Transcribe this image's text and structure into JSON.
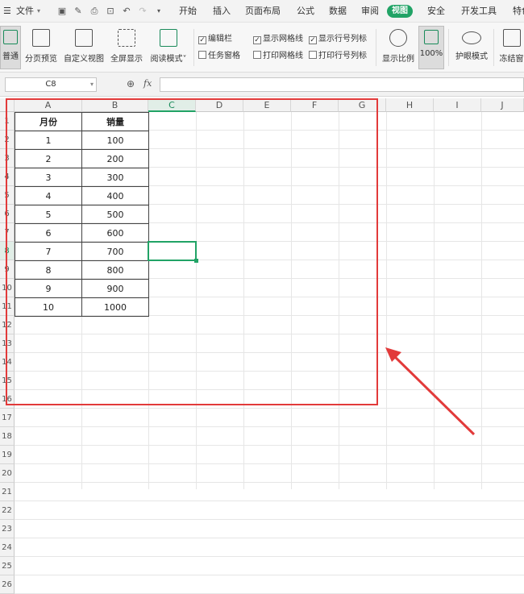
{
  "menubar": {
    "file_label": "文件",
    "tabs": [
      "开始",
      "插入",
      "页面布局",
      "公式",
      "数据",
      "审阅",
      "视图",
      "安全",
      "开发工具",
      "特色"
    ],
    "active_tab": "视图",
    "quick_icons": [
      "save-icon",
      "format-painter-icon",
      "print-icon",
      "print-preview-icon",
      "undo-icon",
      "redo-icon",
      "more-icon"
    ]
  },
  "ribbon": {
    "buttons": [
      {
        "label": "普通",
        "selected": true
      },
      {
        "label": "分页预览",
        "selected": false
      },
      {
        "label": "自定义视图",
        "selected": false
      },
      {
        "label": "全屏显示",
        "selected": false
      },
      {
        "label": "阅读模式",
        "selected": false
      }
    ],
    "checks": [
      {
        "label": "编辑栏",
        "checked": true
      },
      {
        "label": "任务窗格",
        "checked": false
      },
      {
        "label": "显示网格线",
        "checked": true
      },
      {
        "label": "打印网格线",
        "checked": false
      },
      {
        "label": "显示行号列标",
        "checked": true
      },
      {
        "label": "打印行号列标",
        "checked": false
      }
    ],
    "zoom_label": "显示比例",
    "zoom_100_label": "100%",
    "eye_label": "护眼模式",
    "freeze_label": "冻结窗"
  },
  "formula_bar": {
    "name_box": "C8",
    "fx_label": "fx",
    "formula": ""
  },
  "sheet": {
    "columns": [
      "A",
      "B",
      "C",
      "D",
      "E",
      "F",
      "G",
      "H",
      "I",
      "J"
    ],
    "selected_column": "C",
    "selected_row": 8,
    "rows": [
      "1",
      "2",
      "3",
      "4",
      "5",
      "6",
      "7",
      "8",
      "9",
      "10",
      "11",
      "12",
      "13",
      "14",
      "15",
      "16",
      "17",
      "18",
      "19",
      "20",
      "21",
      "22",
      "23",
      "24",
      "25",
      "26"
    ],
    "header": {
      "month": "月份",
      "sales": "销量"
    },
    "data": [
      {
        "month": "1",
        "sales": "100"
      },
      {
        "month": "2",
        "sales": "200"
      },
      {
        "month": "3",
        "sales": "300"
      },
      {
        "month": "4",
        "sales": "400"
      },
      {
        "month": "5",
        "sales": "500"
      },
      {
        "month": "6",
        "sales": "600"
      },
      {
        "month": "7",
        "sales": "700"
      },
      {
        "month": "8",
        "sales": "800"
      },
      {
        "month": "9",
        "sales": "900"
      },
      {
        "month": "10",
        "sales": "1000"
      }
    ]
  },
  "colors": {
    "accent": "#21a366",
    "highlight": "#e23a3a"
  }
}
